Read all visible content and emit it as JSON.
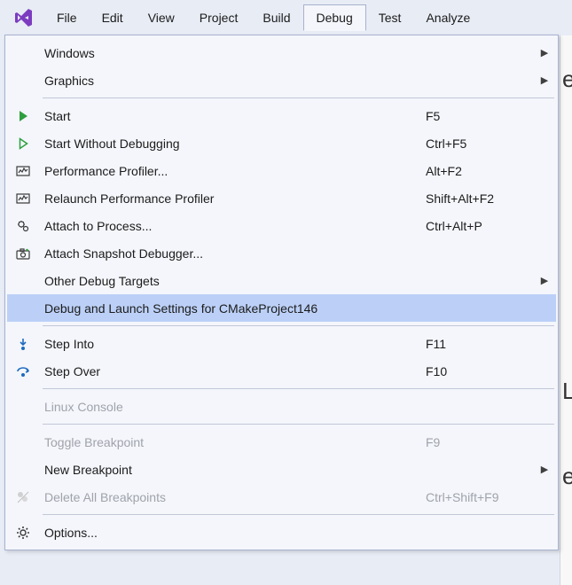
{
  "menubar": {
    "items": [
      "File",
      "Edit",
      "View",
      "Project",
      "Build",
      "Debug",
      "Test",
      "Analyze"
    ],
    "open_index": 5
  },
  "dropdown": {
    "rows": [
      {
        "type": "item",
        "icon": "",
        "label": "Windows",
        "shortcut": "",
        "submenu": true
      },
      {
        "type": "item",
        "icon": "",
        "label": "Graphics",
        "shortcut": "",
        "submenu": true
      },
      {
        "type": "sep"
      },
      {
        "type": "item",
        "icon": "play-green",
        "label": "Start",
        "shortcut": "F5"
      },
      {
        "type": "item",
        "icon": "play-outline",
        "label": "Start Without Debugging",
        "shortcut": "Ctrl+F5"
      },
      {
        "type": "item",
        "icon": "perf-profiler",
        "label": "Performance Profiler...",
        "shortcut": "Alt+F2"
      },
      {
        "type": "item",
        "icon": "perf-profiler",
        "label": "Relaunch Performance Profiler",
        "shortcut": "Shift+Alt+F2"
      },
      {
        "type": "item",
        "icon": "gears",
        "label": "Attach to Process...",
        "shortcut": "Ctrl+Alt+P"
      },
      {
        "type": "item",
        "icon": "camera",
        "label": "Attach Snapshot Debugger...",
        "shortcut": ""
      },
      {
        "type": "item",
        "icon": "",
        "label": "Other Debug Targets",
        "shortcut": "",
        "submenu": true
      },
      {
        "type": "item",
        "icon": "",
        "label": "Debug and Launch Settings for CMakeProject146",
        "shortcut": "",
        "highlight": true
      },
      {
        "type": "sep"
      },
      {
        "type": "item",
        "icon": "step-into",
        "label": "Step Into",
        "shortcut": "F11"
      },
      {
        "type": "item",
        "icon": "step-over",
        "label": "Step Over",
        "shortcut": "F10"
      },
      {
        "type": "sep"
      },
      {
        "type": "item",
        "icon": "",
        "label": "Linux Console",
        "shortcut": "",
        "disabled": true
      },
      {
        "type": "sep"
      },
      {
        "type": "item",
        "icon": "",
        "label": "Toggle Breakpoint",
        "shortcut": "F9",
        "disabled": true
      },
      {
        "type": "item",
        "icon": "",
        "label": "New Breakpoint",
        "shortcut": "",
        "submenu": true
      },
      {
        "type": "item",
        "icon": "delete-bp-disabled",
        "label": "Delete All Breakpoints",
        "shortcut": "Ctrl+Shift+F9",
        "disabled": true
      },
      {
        "type": "sep"
      },
      {
        "type": "item",
        "icon": "gear",
        "label": "Options...",
        "shortcut": ""
      }
    ]
  },
  "background_letters": [
    "e",
    "",
    "",
    "",
    "",
    "",
    "",
    "",
    "",
    "",
    "",
    "L",
    "",
    "",
    "e"
  ]
}
